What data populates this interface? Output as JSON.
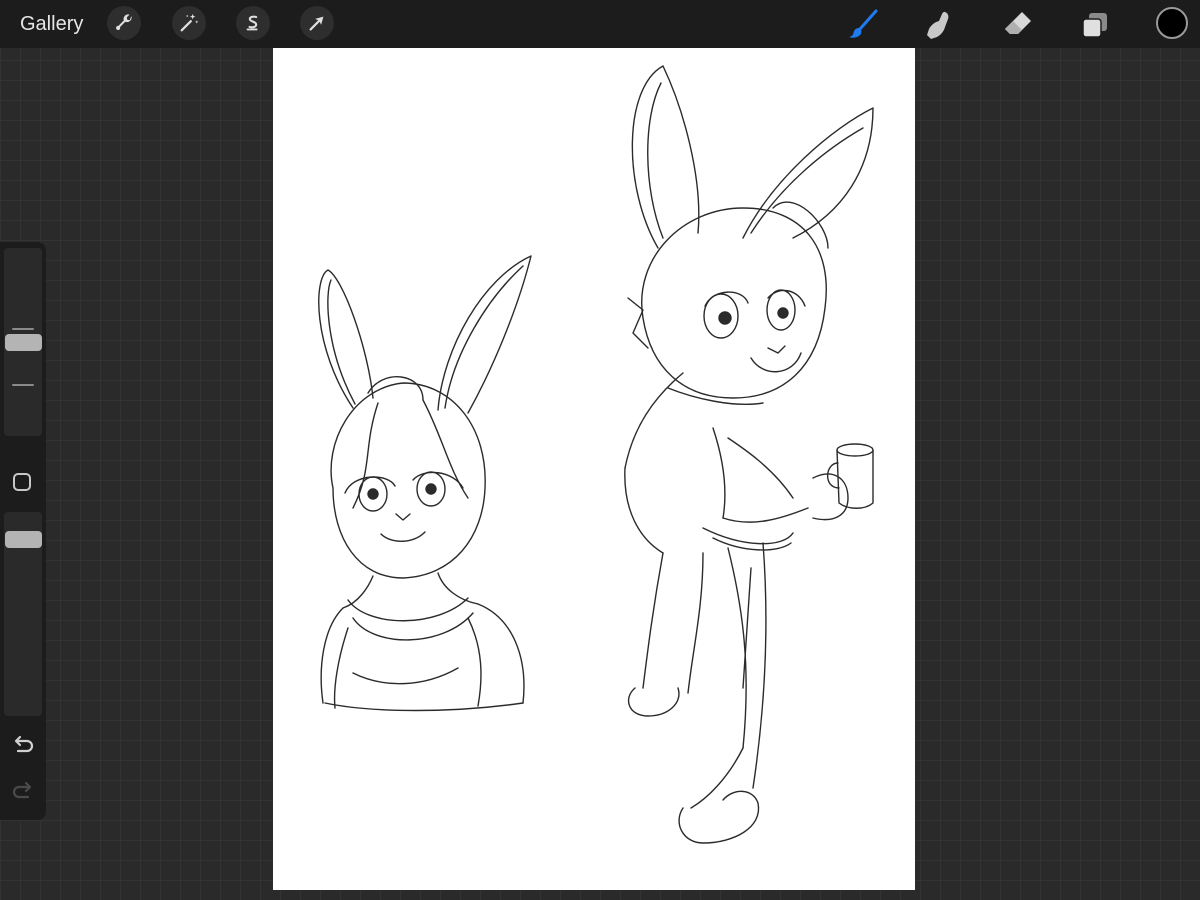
{
  "topbar": {
    "gallery_label": "Gallery",
    "actions_icon": "wrench-icon",
    "adjustments_icon": "magic-wand-icon",
    "selection_icon": "selection-s-icon",
    "transform_icon": "arrow-cursor-icon",
    "brush_icon": "brush-icon",
    "smudge_icon": "smudge-finger-icon",
    "eraser_icon": "eraser-icon",
    "layers_icon": "layers-icon",
    "active_tool": "brush",
    "accent_color": "#1f7cf0",
    "current_color": "#000000"
  },
  "sidebar": {
    "brush_size_level": 0.5,
    "opacity_level": 0.9,
    "modify_icon": "square-modify-icon",
    "undo_icon": "undo-icon",
    "redo_icon": "redo-icon",
    "redo_enabled": false
  },
  "canvas": {
    "background": "#ffffff",
    "artwork": "pencil-sketch-two-rabbit-characters"
  }
}
